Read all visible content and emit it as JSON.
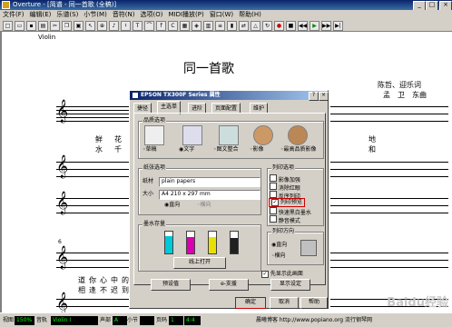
{
  "window": {
    "title": "Overture - [简谱 - 同一首歌 (全稿)]"
  },
  "menu": [
    "文件(F)",
    "编辑(E)",
    "乐谱(S)",
    "小节(M)",
    "音符(N)",
    "选项(O)",
    "MIDI播放(P)",
    "窗口(W)",
    "帮助(H)"
  ],
  "score": {
    "title": "同一首歌",
    "lyricist": "陈哲、迎乐词",
    "composer": "孟　卫　东曲",
    "lyrics_row1": [
      "鲜",
      "花"
    ],
    "lyrics_row1b": [
      "水",
      "千"
    ],
    "lyrics_right1": [
      "地",
      "和"
    ],
    "lyrics_row2": [
      "道",
      "你",
      "心",
      "中",
      "的"
    ],
    "lyrics_row2b": [
      "相",
      "逢",
      "不",
      "迟",
      "到"
    ],
    "staff_header": "Violin",
    "measure_number": "6"
  },
  "dialog": {
    "title": "EPSON TX300F Series 属性",
    "tabs": [
      "捷径",
      "主选单",
      "进阶",
      "页面配置",
      "维护"
    ],
    "quality": {
      "label": "品质选项",
      "options": [
        "草稿",
        "文字",
        "图文整合",
        "影像",
        "最高品质影像"
      ]
    },
    "paper": {
      "label": "纸张选项",
      "source_label": "纸材",
      "source_value": "plain papers",
      "size_label": "大小",
      "size_value": "A4 210 x 297 mm",
      "orient_portrait": "直向",
      "orient_landscape": "横向"
    },
    "print_options": {
      "label": "列印选项",
      "items": [
        "影像加强",
        "消除红眼",
        "反序列印",
        "列印预览",
        "快速黑白墨水",
        "静音模式"
      ],
      "checked_index": 3
    },
    "ink": {
      "label": "墨水存量",
      "button": "线上打开",
      "levels": [
        0.8,
        0.75,
        0.75,
        0.7
      ]
    },
    "orientation": {
      "label": "列印方向",
      "portrait": "直向",
      "landscape": "横向"
    },
    "show_settings": "先显示此画面",
    "settings_btn": "预设值",
    "vtech_btn": "e-支援",
    "show_btn": "显示设定",
    "ok": "确定",
    "cancel": "取消",
    "help": "帮助"
  },
  "status": {
    "view_label": "视图",
    "view_value": "150%",
    "track_label": "音轨",
    "track_value": "Violin I",
    "voice_label": "声部",
    "voice_value": "A",
    "measure_label": "小节",
    "page_label": "页码",
    "page_value": "1",
    "time_value": "4:4",
    "website": "晨曦博客 http://www.popiano.org 流行钢琴网"
  },
  "watermark": "Baidu经验",
  "colors": {
    "accent": "#0a246a",
    "highlight_box": "#cc0000"
  }
}
